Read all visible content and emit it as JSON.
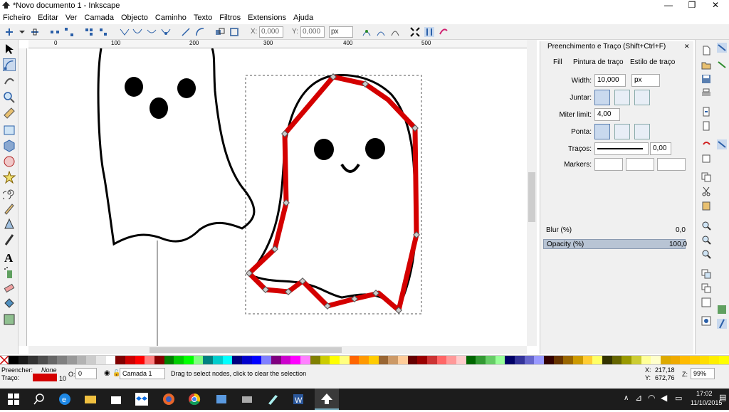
{
  "window": {
    "title": "*Novo documento 1 - Inkscape"
  },
  "menu": [
    "Ficheiro",
    "Editar",
    "Ver",
    "Camada",
    "Objecto",
    "Caminho",
    "Texto",
    "Filtros",
    "Extensions",
    "Ajuda"
  ],
  "toolbar": {
    "x_label": "X:",
    "x_value": "0,000",
    "y_label": "Y:",
    "y_value": "0,000",
    "unit": "px"
  },
  "panel": {
    "title": "Preenchimento e Traço (Shift+Ctrl+F)",
    "tabs": [
      "Fill",
      "Pintura de traço",
      "Estilo de traço"
    ],
    "width_label": "Width:",
    "width_value": "10,000",
    "width_unit": "px",
    "join_label": "Juntar:",
    "miter_label": "Miter limit:",
    "miter_value": "4,00",
    "cap_label": "Ponta:",
    "dashes_label": "Traços:",
    "dashes_value": "0,00",
    "markers_label": "Markers:",
    "blur_label": "Blur (%)",
    "blur_value": "0,0",
    "opacity_label": "Opacity (%)",
    "opacity_value": "100,0"
  },
  "status": {
    "fill_label": "Preencher:",
    "fill_value": "None",
    "stroke_label": "Traço:",
    "stroke_width": "10",
    "opacity_label": "O:",
    "opacity_value": "0",
    "layer": "Camada 1",
    "message": "Drag to select nodes, click to clear the selection",
    "coord_x_label": "X:",
    "coord_x": "217,18",
    "coord_y_label": "Y:",
    "coord_y": "672,76",
    "zoom_label": "Z:",
    "zoom": "99%"
  },
  "ruler_top": [
    "0",
    "100",
    "200",
    "300",
    "400",
    "500"
  ],
  "taskbar": {
    "time": "17:02",
    "date": "11/10/2015"
  },
  "colors": {
    "stroke_red": "#d40000",
    "accent": "#2b7fd7"
  }
}
